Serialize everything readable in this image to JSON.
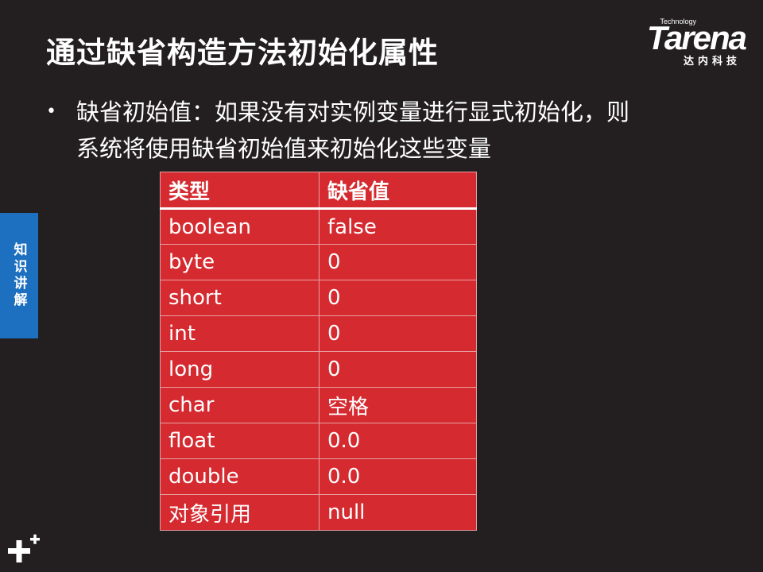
{
  "slide": {
    "title": "通过缺省构造方法初始化属性",
    "logo": {
      "technology": "Technology",
      "brand": "Tarena",
      "chinese": "达内科技"
    },
    "bullet": {
      "line1": "缺省初始值：如果没有对实例变量进行显式初始化，则",
      "line2": "系统将使用缺省初始值来初始化这些变量"
    },
    "side_tab": "知识讲解",
    "table": {
      "headers": [
        "类型",
        "缺省值"
      ],
      "rows": [
        [
          "boolean",
          "false"
        ],
        [
          "byte",
          "0"
        ],
        [
          "short",
          "0"
        ],
        [
          "int",
          "0"
        ],
        [
          "long",
          "0"
        ],
        [
          "char",
          "空格"
        ],
        [
          "float",
          "0.0"
        ],
        [
          "double",
          "0.0"
        ],
        [
          "对象引用",
          "null"
        ]
      ]
    }
  }
}
